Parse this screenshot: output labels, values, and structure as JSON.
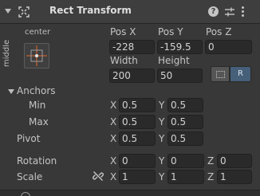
{
  "header": {
    "title": "Rect Transform",
    "help_icon_glyph": "?",
    "icons": [
      "foldout-arrow-icon",
      "rect-transform-icon",
      "help-icon",
      "settings-sliders-icon",
      "kebab-menu-icon"
    ]
  },
  "anchor_preset": {
    "horizontal_label": "center",
    "vertical_label": "middle",
    "accent_color": "#e06a2a"
  },
  "position": {
    "pos_x_label": "Pos X",
    "pos_y_label": "Pos Y",
    "pos_z_label": "Pos Z",
    "pos_x": "-228",
    "pos_y": "-159.5",
    "pos_z": "0",
    "width_label": "Width",
    "height_label": "Height",
    "width": "200",
    "height": "50"
  },
  "buttons": {
    "raw_edit_icon": "dotted-rect-icon",
    "blueprint_label": "R",
    "blueprint_color": "#46607a"
  },
  "anchors": {
    "label": "Anchors",
    "min_label": "Min",
    "max_label": "Max",
    "min_x": "0.5",
    "min_y": "0.5",
    "max_x": "0.5",
    "max_y": "0.5"
  },
  "pivot": {
    "label": "Pivot",
    "x": "0.5",
    "y": "0.5"
  },
  "rotation": {
    "label": "Rotation",
    "x": "0",
    "y": "0",
    "z": "0"
  },
  "scale": {
    "label": "Scale",
    "x": "1",
    "y": "1",
    "z": "1"
  },
  "axes": {
    "x": "X",
    "y": "Y",
    "z": "Z"
  }
}
